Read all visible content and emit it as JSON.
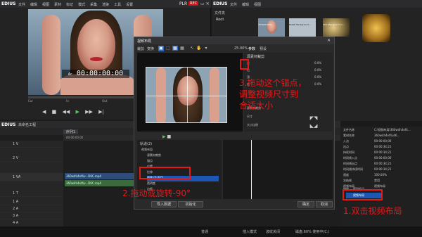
{
  "player": {
    "app": "EDIUS",
    "menu": [
      "文件",
      "编辑",
      "视图",
      "素材",
      "标记",
      "模式",
      "采集",
      "渲染",
      "工具",
      "设置"
    ],
    "mode": "PLR",
    "rec": "REC",
    "timecode": "00:00:00:00",
    "tc_label": "Ac",
    "in_label": "In",
    "out_label": "Out",
    "dur_label": "Dur",
    "cue_label": "Cur"
  },
  "bin": {
    "app": "EDIUS",
    "menu": [
      "文件",
      "编辑",
      "视图"
    ],
    "folder": "文件夹",
    "root": "Root",
    "thumbs": [
      "360w4h4ef4...",
      "Bokeh Background...",
      "Ab6 Shanghai Cou..."
    ]
  },
  "timeline": {
    "app": "EDIUS",
    "title": "未命名工程",
    "seq_tab": "序列1",
    "tracks": [
      {
        "name": "1 V"
      },
      {
        "name": "2 V"
      },
      {
        "name": "1 VA"
      },
      {
        "name": "1 T"
      },
      {
        "name": "1 A"
      },
      {
        "name": "2 A"
      },
      {
        "name": "3 A"
      },
      {
        "name": "4 A"
      }
    ],
    "ruler": [
      "00:00:00:00",
      "00:00:05:00",
      "00:00:10:00"
    ],
    "clip_label": "360w4h4ef4u...D6C.mp4",
    "clip_label_2": "360w4h4ef4u...D6C.mp4"
  },
  "dialog": {
    "title": "视频布局",
    "tabs": [
      "裁剪",
      "变换"
    ],
    "zoom": "25.00%",
    "right_tabs": [
      "参数",
      "预设"
    ],
    "params_header": "源素材裁剪",
    "params": [
      {
        "label": "左",
        "value": "0.0%"
      },
      {
        "label": "右",
        "value": "0.0%"
      },
      {
        "label": "顶",
        "value": "0.0%"
      },
      {
        "label": "底",
        "value": "0.0%"
      }
    ],
    "aspect_label": "源素材裁剪",
    "transform_header": "变换",
    "transform_items": [
      "位置",
      "拉伸",
      "旋转"
    ],
    "list_header": "轨道(2)",
    "list_items": [
      "视频布局",
      "源素材裁剪",
      "锚点",
      "位置",
      "拉伸",
      "旋转 (0.00°)",
      "透明度",
      "边框"
    ],
    "selected_item": "旋转 (0.00°)",
    "buttons": {
      "default": "导入数据",
      "init": "初始化",
      "ok": "确定",
      "cancel": "取消"
    },
    "size_label": "尺寸",
    "frame_label": "大小比例"
  },
  "info": {
    "rows": [
      {
        "label": "文件名称",
        "value": "C:\\视频布局\\360w4h4ef4..."
      },
      {
        "label": "素材名称",
        "value": "360w4h4ef4u46..."
      },
      {
        "label": "入点",
        "value": "00:00:00;00"
      },
      {
        "label": "出点",
        "value": "00:00:34;21"
      },
      {
        "label": "持续时间",
        "value": "00:00:34;21"
      },
      {
        "label": "时间线入点",
        "value": "00:00:00;00"
      },
      {
        "label": "时间线出点",
        "value": "00:00:34;21"
      },
      {
        "label": "时间线持续时间",
        "value": "00:00:34;21"
      },
      {
        "label": "速度",
        "value": "100.00%"
      },
      {
        "label": "冻结帧",
        "value": "禁用"
      },
      {
        "label": "视频布局",
        "value": "视频布局"
      }
    ],
    "tabs": [
      "特效",
      "序列标记"
    ],
    "layout_item": "视频布局"
  },
  "status": {
    "items": [
      "普通",
      "插入模式",
      "波纹关闭",
      "磁盘:60% 使用中(C:)"
    ]
  },
  "annotations": {
    "a1": "1.双击视频布局",
    "a2": "2.拖动或旋转-90°",
    "a3": "3.拖动这个锚点，\n调整视频尺寸到\n合适大小"
  },
  "colors": {
    "annotation": "#e61919",
    "accent": "#2c6bc4",
    "selection": "#1c57b3"
  }
}
